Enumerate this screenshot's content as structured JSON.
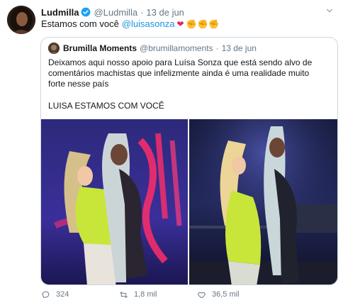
{
  "tweet": {
    "author_name": "Ludmilla",
    "author_handle": "@Ludmilla",
    "separator": "·",
    "date": "13 de jun",
    "text": "Estamos com você",
    "mention": "@luisasonza",
    "emoji_heart": "❤",
    "emoji_fists": "✊✊✊"
  },
  "quoted": {
    "author_name": "Brumilla Moments",
    "author_handle": "@brumillamoments",
    "separator": "·",
    "date": "13 de jun",
    "line1": "Deixamos aqui nosso apoio para Luísa Sonza que está sendo alvo de",
    "line2": "comentários machistas que infelizmente ainda é uma realidade muito",
    "line3": "forte nesse país",
    "line4": "LUISA ESTAMOS COM VOCÊ"
  },
  "actions": {
    "reply_count": "324",
    "retweet_count": "1,8 mil",
    "like_count": "36,5 mil"
  },
  "colors": {
    "link": "#1b95e0",
    "text": "#14171a",
    "muted": "#657786",
    "border": "#ccd6dd",
    "verified": "#1da1f2",
    "heart": "#e0245e"
  },
  "icons": {
    "verified": "verified-badge-icon",
    "menu": "chevron-down-icon",
    "reply": "reply-icon",
    "retweet": "retweet-icon",
    "like": "heart-icon"
  }
}
